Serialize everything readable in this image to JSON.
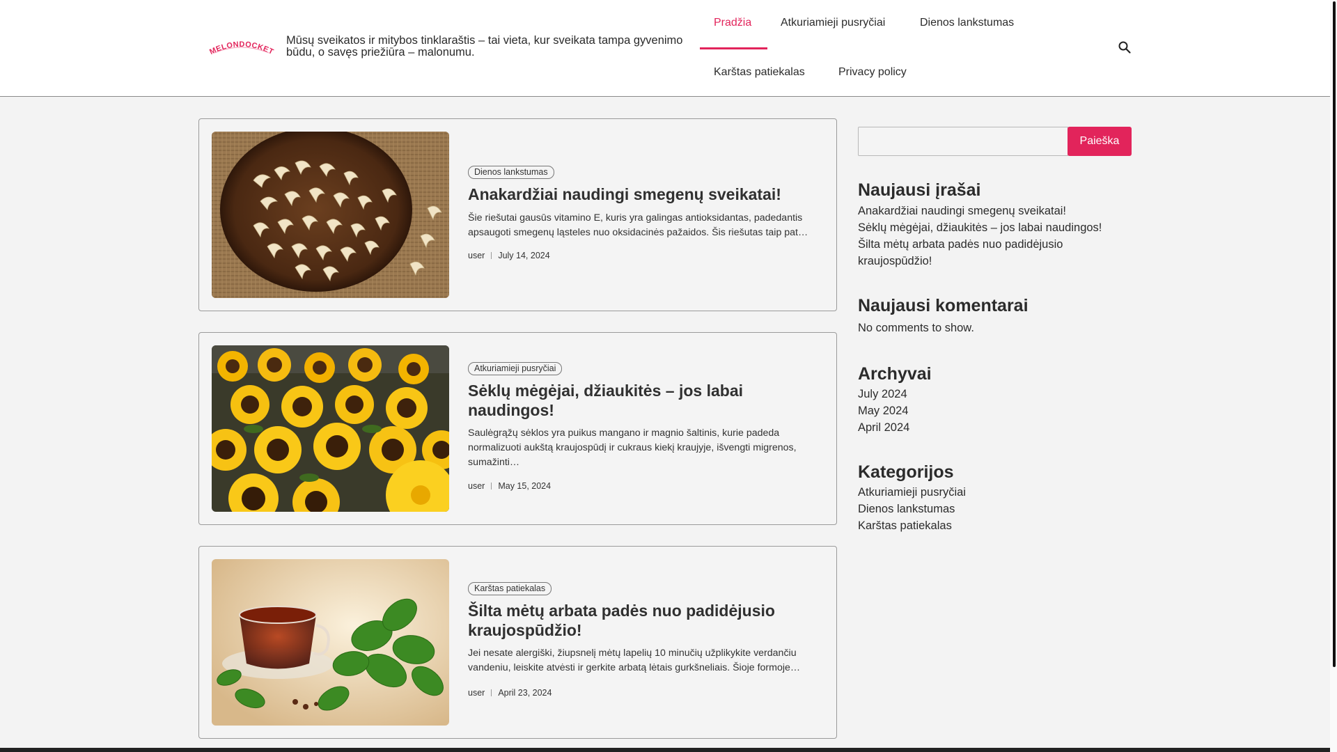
{
  "header": {
    "logo_text": "MELONDOCKET",
    "tagline": "Mūsų sveikatos ir mitybos tinklaraštis – tai vieta, kur sveikata tampa gyvenimo būdu, o savęs priežiūra – malonumu.",
    "nav": [
      {
        "label": "Pradžia"
      },
      {
        "label": "Atkuriamieji pusryčiai"
      },
      {
        "label": "Dienos lankstumas"
      },
      {
        "label": "Karštas patiekalas"
      },
      {
        "label": "Privacy policy"
      }
    ],
    "active_nav": "Pradžia",
    "search_icon": "search-icon"
  },
  "posts": [
    {
      "category": "Dienos lankstumas",
      "title": "Anakardžiai naudingi smegenų sveikatai!",
      "excerpt": "Šie riešutai gausūs vitamino E, kuris yra galingas antioksidantas, padedantis apsaugoti smegenų ląsteles nuo oksidacinės pažaidos. Šis riešutas taip pat…",
      "author": "user",
      "date": "July 14, 2024",
      "image": "cashews-image"
    },
    {
      "category": "Atkuriamieji pusryčiai",
      "title": "Sėklų mėgėjai, džiaukitės – jos labai naudingos!",
      "excerpt": "Saulėgrąžų sėklos yra puikus mangano ir magnio šaltinis, kurie padeda normalizuoti aukštą kraujospūdį ir cukraus kiekį kraujyje, išvengti migrenos, sumažinti…",
      "author": "user",
      "date": "May 15, 2024",
      "image": "sunflowers-image"
    },
    {
      "category": "Karštas patiekalas",
      "title": "Šilta mėtų arbata padės nuo padidėjusio kraujospūdžio!",
      "excerpt": "Jei nesate alergiški, žiupsnelį mėtų lapelių 10 minučių užplikykite verdančiu vandeniu, leiskite atvėsti ir gerkite arbatą lėtais gurkšneliais. Šioje formoje…",
      "author": "user",
      "date": "April 23, 2024",
      "image": "mint-tea-image"
    }
  ],
  "sidebar": {
    "search_value": "",
    "search_button": "Paieška",
    "recent_title": "Naujausi įrašai",
    "recent_posts": [
      "Anakardžiai naudingi smegenų sveikatai!",
      "Sėklų mėgėjai, džiaukitės – jos labai naudingos!",
      "Šilta mėtų arbata padės nuo padidėjusio kraujospūdžio!"
    ],
    "comments_title": "Naujausi komentarai",
    "comments_text": "No comments to show.",
    "archives_title": "Archyvai",
    "archives": [
      "July 2024",
      "May 2024",
      "April 2024"
    ],
    "categories_title": "Kategorijos",
    "categories": [
      "Atkuriamieji pusryčiai",
      "Dienos lankstumas",
      "Karštas patiekalas"
    ]
  },
  "colors": {
    "accent": "#e2245b",
    "background": "#f3f3f3"
  }
}
